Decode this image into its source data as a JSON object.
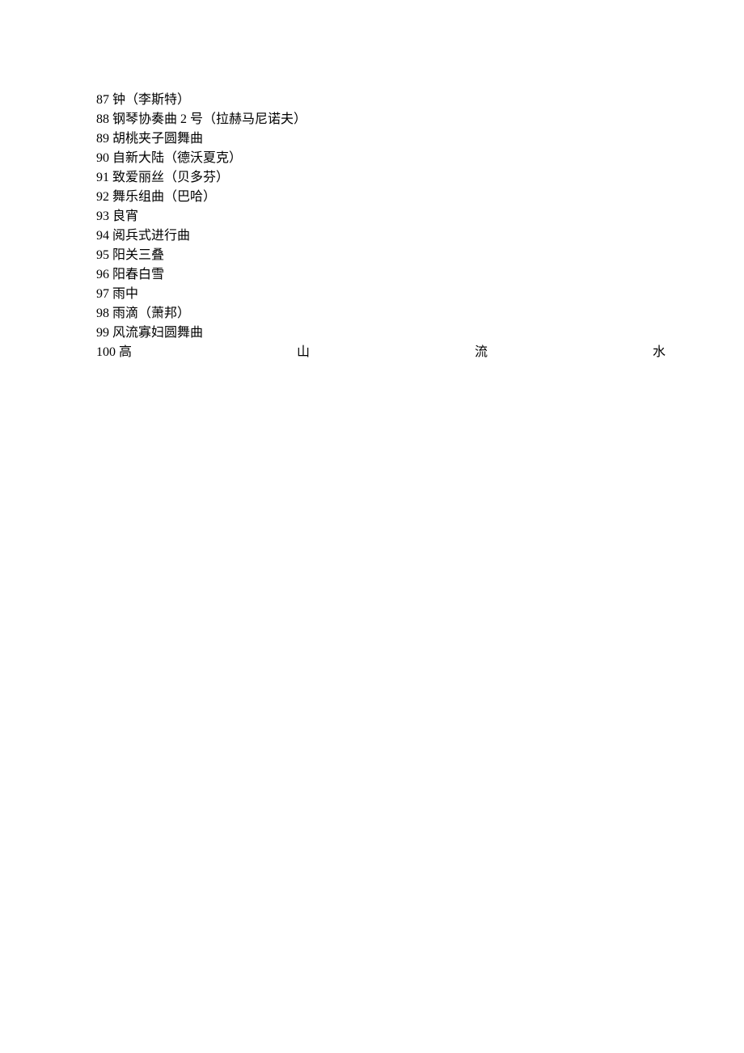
{
  "items": [
    {
      "num": "87",
      "text": "钟（李斯特）"
    },
    {
      "num": "88",
      "text": "钢琴协奏曲 2 号（拉赫马尼诺夫）"
    },
    {
      "num": "89",
      "text": "胡桃夹子圆舞曲"
    },
    {
      "num": "90",
      "text": "自新大陆（德沃夏克）"
    },
    {
      "num": "91",
      "text": "致爱丽丝（贝多芬）"
    },
    {
      "num": "92",
      "text": "舞乐组曲（巴哈）"
    },
    {
      "num": "93",
      "text": "良宵"
    },
    {
      "num": "94",
      "text": "阅兵式进行曲"
    },
    {
      "num": "95",
      "text": "阳关三叠"
    },
    {
      "num": "96",
      "text": "阳春白雪"
    },
    {
      "num": "97",
      "text": "雨中"
    },
    {
      "num": "98",
      "text": "雨滴（萧邦）"
    },
    {
      "num": "99",
      "text": "风流寡妇圆舞曲"
    }
  ],
  "justified": {
    "num": "100",
    "chars": [
      "高",
      "山",
      "流",
      "水"
    ]
  }
}
